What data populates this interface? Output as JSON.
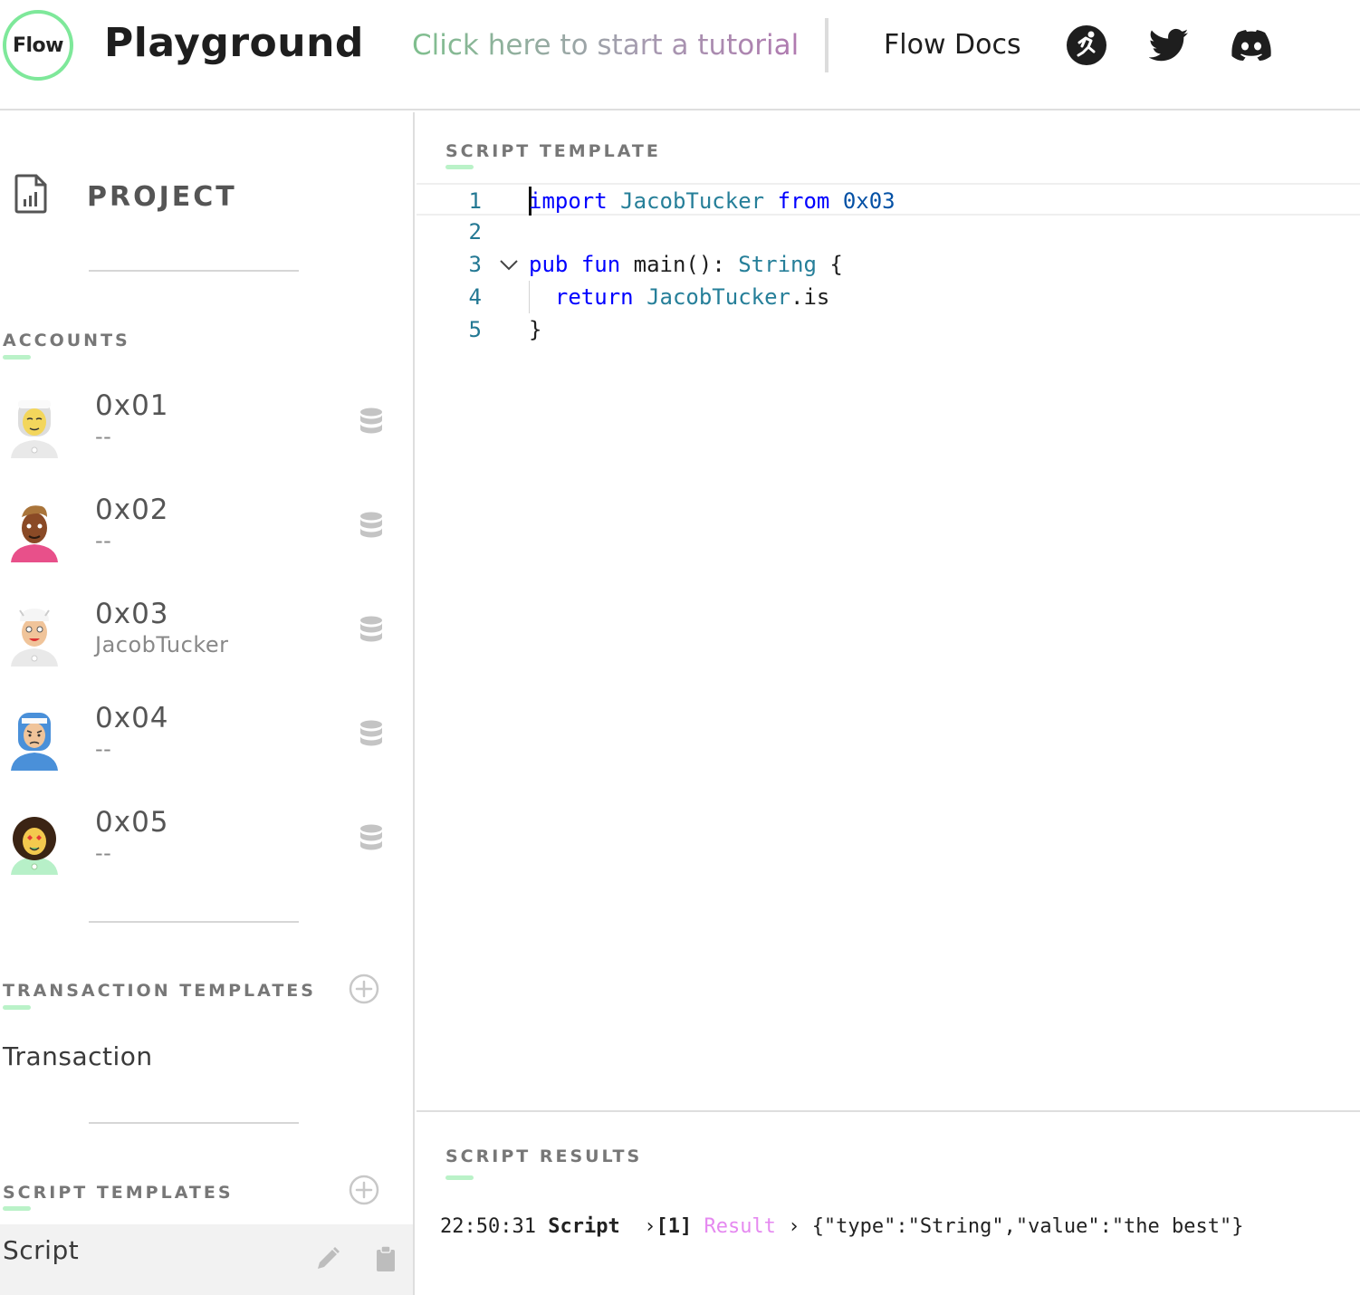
{
  "header": {
    "logo_text": "Flow",
    "title": "Playground",
    "tutorial_link": "Click here to start a tutorial",
    "docs_link": "Flow Docs",
    "icons": [
      "forum-runner-icon",
      "twitter-icon",
      "discord-icon"
    ]
  },
  "sidebar": {
    "project_label": "PROJECT",
    "accounts_label": "ACCOUNTS",
    "accounts": [
      {
        "address": "0x01",
        "name": "--",
        "avatar_color": "#f3d65c"
      },
      {
        "address": "0x02",
        "name": "--",
        "avatar_color": "#e8508a"
      },
      {
        "address": "0x03",
        "name": "JacobTucker",
        "avatar_color": "#e9e9e9"
      },
      {
        "address": "0x04",
        "name": "--",
        "avatar_color": "#4a90d9"
      },
      {
        "address": "0x05",
        "name": "--",
        "avatar_color": "#b7f0c8"
      }
    ],
    "transaction_templates_label": "TRANSACTION TEMPLATES",
    "transaction_items": [
      "Transaction"
    ],
    "script_templates_label": "SCRIPT TEMPLATES",
    "script_items": [
      "Script"
    ]
  },
  "editor": {
    "label": "SCRIPT TEMPLATE",
    "line_numbers": [
      "1",
      "2",
      "3",
      "4",
      "5"
    ],
    "lines": [
      "import JacobTucker from 0x03",
      "",
      "pub fun main(): String {",
      "  return JacobTucker.is",
      "}"
    ]
  },
  "results": {
    "label": "SCRIPT RESULTS",
    "time": "22:50:31",
    "source": "Script",
    "index": "[1]",
    "kind": "Result",
    "value": "{\"type\":\"String\",\"value\":\"the best\"}"
  },
  "colors": {
    "accent_green": "#7ee89a",
    "underline_green": "#baf2c8",
    "keyword": "#0000ff",
    "type": "#267f99",
    "line_number": "#237893",
    "result_pink": "#e589f0"
  }
}
